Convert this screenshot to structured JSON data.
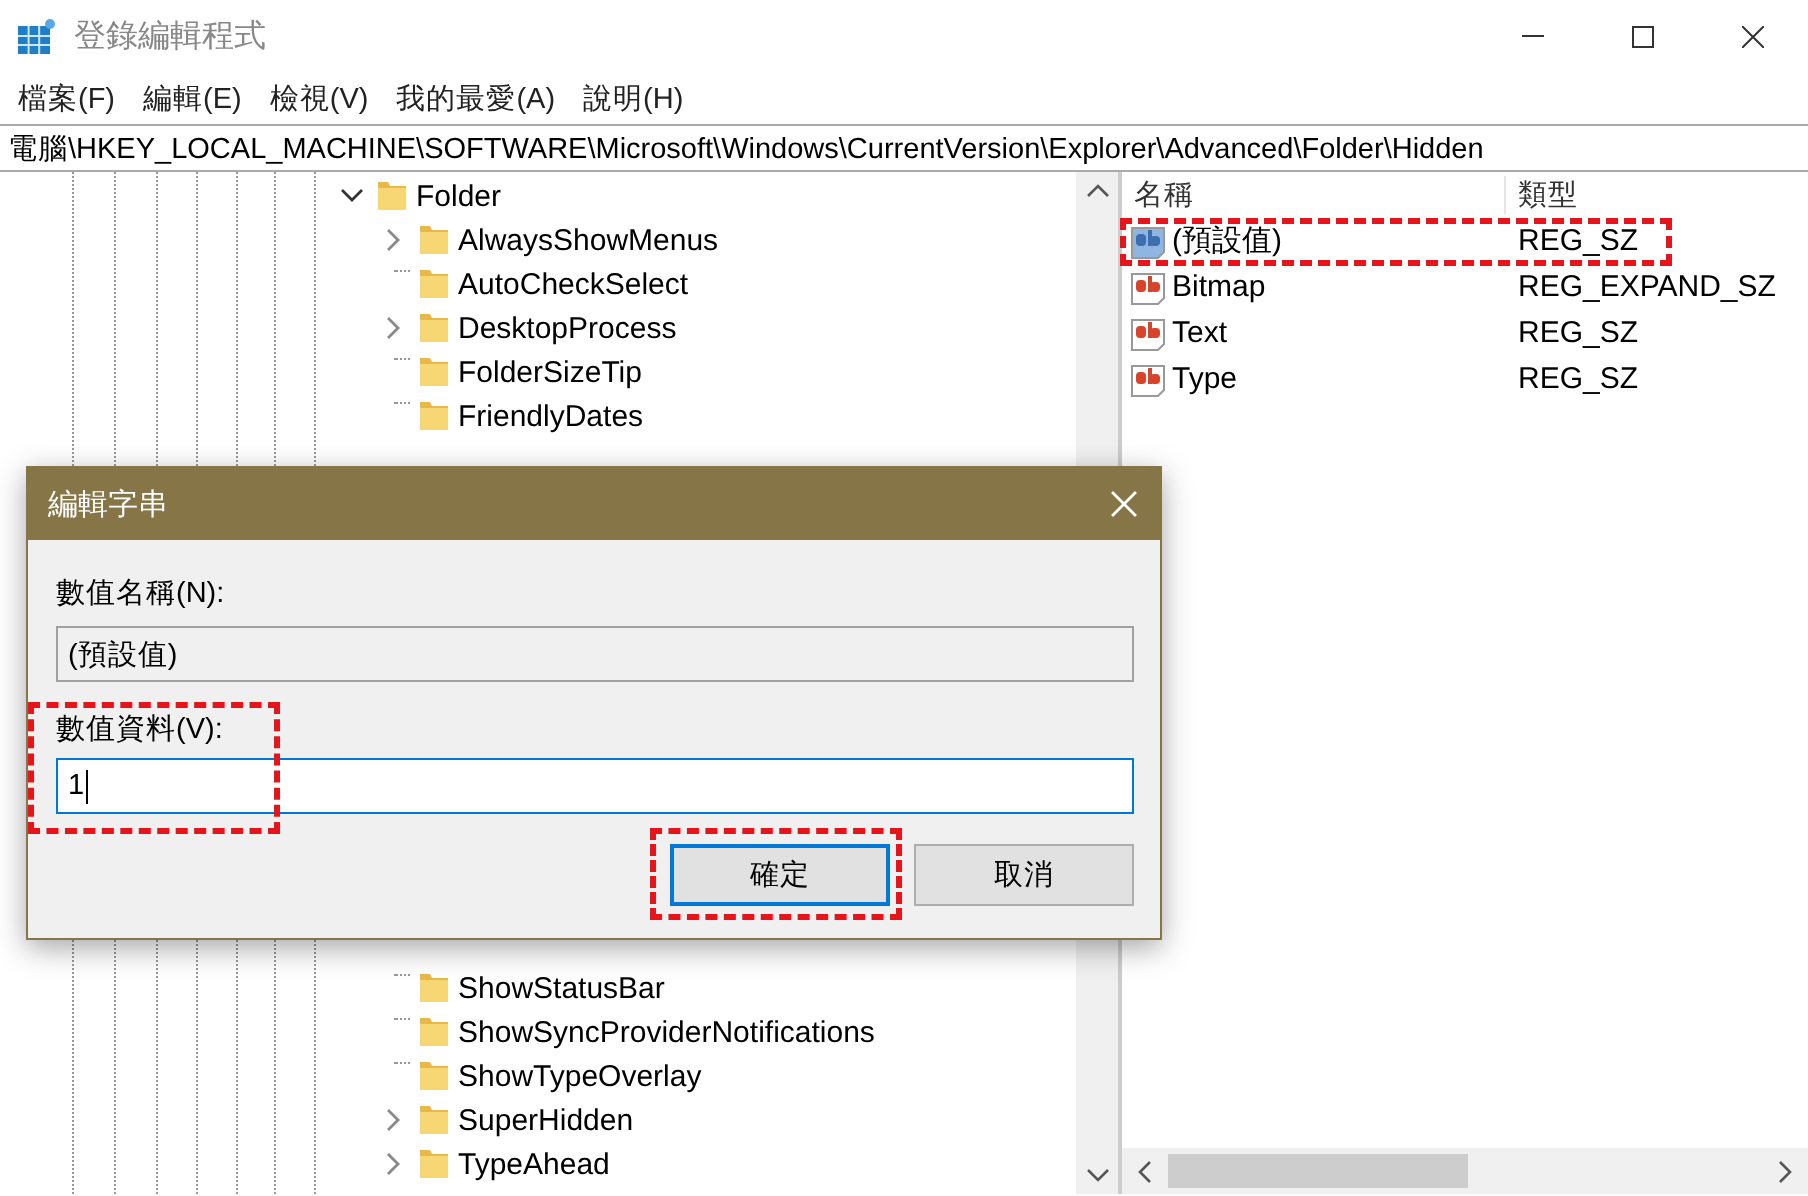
{
  "window": {
    "title": "登錄編輯程式"
  },
  "menu": [
    "檔案(F)",
    "編輯(E)",
    "檢視(V)",
    "我的最愛(A)",
    "說明(H)"
  ],
  "address": "電腦\\HKEY_LOCAL_MACHINE\\SOFTWARE\\Microsoft\\Windows\\CurrentVersion\\Explorer\\Advanced\\Folder\\Hidden",
  "tree": {
    "label": "Folder",
    "expanded": true,
    "children": [
      {
        "label": "AlwaysShowMenus",
        "expandable": true,
        "selected": false
      },
      {
        "label": "AutoCheckSelect",
        "expandable": false,
        "selected": false
      },
      {
        "label": "DesktopProcess",
        "expandable": true,
        "selected": false
      },
      {
        "label": "FolderSizeTip",
        "expandable": false,
        "selected": false
      },
      {
        "label": "FriendlyDates",
        "expandable": false,
        "selected": false
      },
      {
        "label": "ShowStatusBar",
        "expandable": false,
        "selected": false
      },
      {
        "label": "ShowSyncProviderNotifications",
        "expandable": false,
        "selected": false
      },
      {
        "label": "ShowTypeOverlay",
        "expandable": false,
        "selected": false
      },
      {
        "label": "SuperHidden",
        "expandable": true,
        "selected": false
      },
      {
        "label": "TypeAhead",
        "expandable": true,
        "selected": false
      }
    ]
  },
  "values": {
    "columns": [
      "名稱",
      "類型"
    ],
    "rows": [
      {
        "name": "(預設值)",
        "type": "REG_SZ",
        "selected": true,
        "annotated": true
      },
      {
        "name": "Bitmap",
        "type": "REG_EXPAND_SZ",
        "selected": false,
        "annotated": false
      },
      {
        "name": "Text",
        "type": "REG_SZ",
        "selected": false,
        "annotated": false
      },
      {
        "name": "Type",
        "type": "REG_SZ",
        "selected": false,
        "annotated": false
      }
    ]
  },
  "dialog": {
    "title": "編輯字串",
    "name_label": "數值名稱(N):",
    "name_value": "(預設值)",
    "data_label": "數值資料(V):",
    "data_value": "1",
    "data_annotated": true,
    "buttons": [
      {
        "label": "確定",
        "default": true,
        "annotated": true
      },
      {
        "label": "取消",
        "default": false,
        "annotated": false
      }
    ]
  }
}
